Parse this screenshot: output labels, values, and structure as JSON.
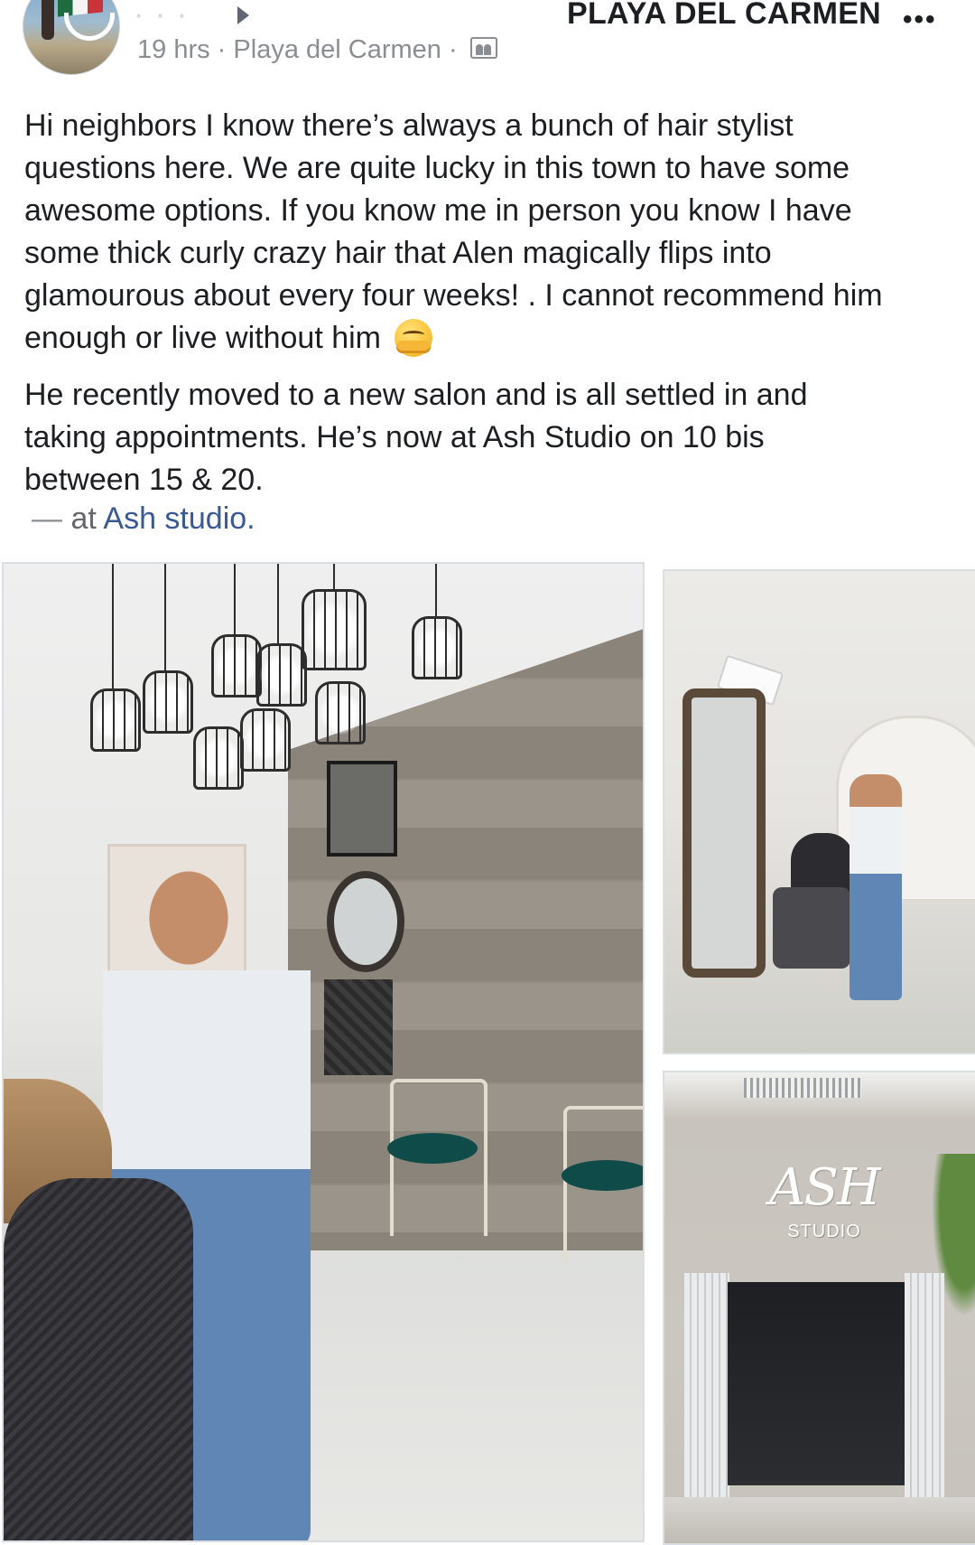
{
  "post": {
    "author": "· · ·",
    "group": "PLAYA DEL CARMEN",
    "meta_time": "19 hrs",
    "meta_location": "Playa del Carmen",
    "separator": "·",
    "more_label": "•••",
    "body_paragraph_1": "Hi neighbors I know there’s always a bunch of hair stylist\nquestions here. We are quite lucky in this town to have some\nawesome options. If you know me in person you know I have\nsome thick curly crazy hair that Alen magically flips into\nglamourous about every four weeks! . I cannot recommend him\nenough or live without him",
    "body_paragraph_2": "He recently moved to a new salon and is all settled in and\ntaking appointments. He’s now at Ash Studio on 10 bis\nbetween 15 & 20.",
    "location_dash": "—",
    "location_prefix": "at",
    "location_name": "Ash studio",
    "location_suffix": "."
  },
  "photos": {
    "storefront_logo": "ASH",
    "storefront_sub": "STUDIO"
  },
  "icons": {
    "avatar": "profile-avatar",
    "share_arrow": "triangle-right-icon",
    "audience": "group-audience-icon",
    "emoji": "hugging-face-emoji",
    "more": "more-options-icon"
  },
  "colors": {
    "text": "#1c1e21",
    "meta": "#8a8d91",
    "link": "#385898"
  }
}
